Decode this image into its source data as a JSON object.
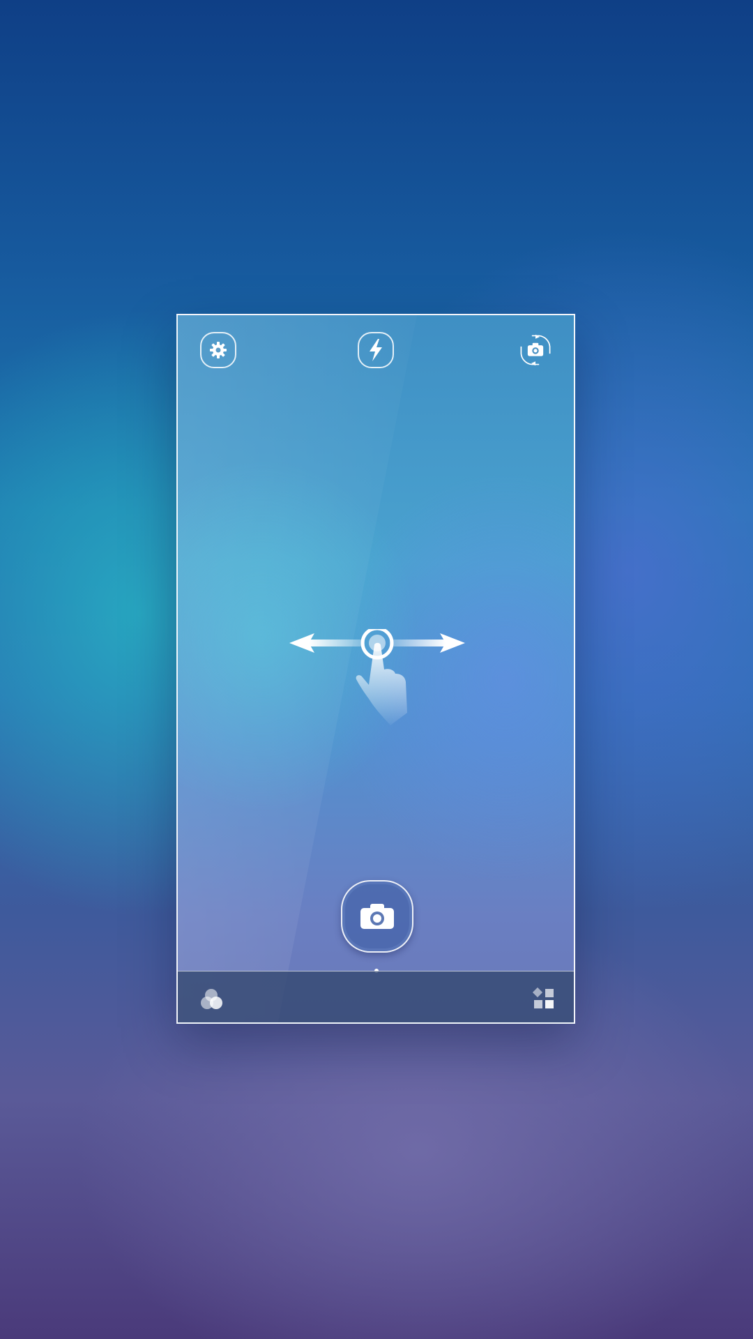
{
  "screen": {
    "title": "",
    "colors": {
      "frame_border": "#ffffff",
      "icon": "#ffffff",
      "bottom_bar": "#32466e",
      "shutter_fill": "#4664aa"
    }
  },
  "top_bar": {
    "left_icon": "gear-icon",
    "center_icon": "flash-icon",
    "right_icon": "camera-switch-icon"
  },
  "viewfinder": {
    "hint_icon": "swipe-horizontal-gesture-icon"
  },
  "shutter": {
    "icon": "camera-icon"
  },
  "pager": {
    "current_page": 1
  },
  "bottom_bar": {
    "left_icon": "filter-effects-icon",
    "right_icon": "camera-modes-icon"
  }
}
